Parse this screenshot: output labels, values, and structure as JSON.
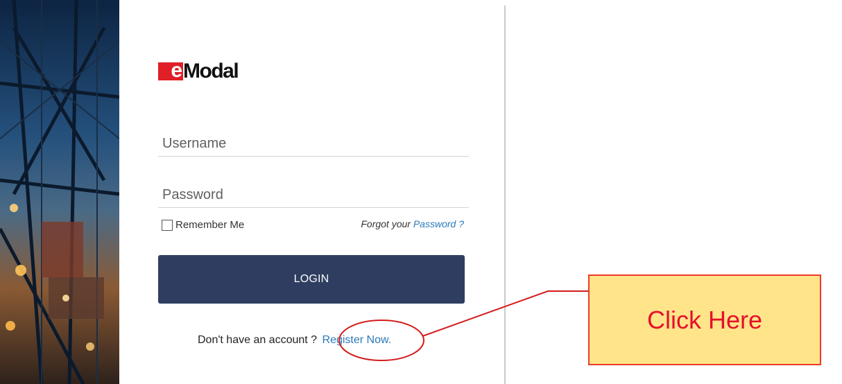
{
  "brand": {
    "logo_mark": "e",
    "logo_word": "Modal"
  },
  "login_form": {
    "username_placeholder": "Username",
    "password_placeholder": "Password",
    "remember_label": "Remember Me",
    "forgot_prefix": "Forgot your",
    "forgot_link": "Password ?",
    "login_label": "LOGIN",
    "register_prompt": "Don't have an account ?",
    "register_link": "Register Now."
  },
  "annotation": {
    "callout_text": "Click Here",
    "callout_color": "#e6102a",
    "callout_fill": "#ffe48a"
  },
  "colors": {
    "brand_red": "#e01f26",
    "button_navy": "#2f3e60",
    "link_blue": "#2a7ab8"
  }
}
